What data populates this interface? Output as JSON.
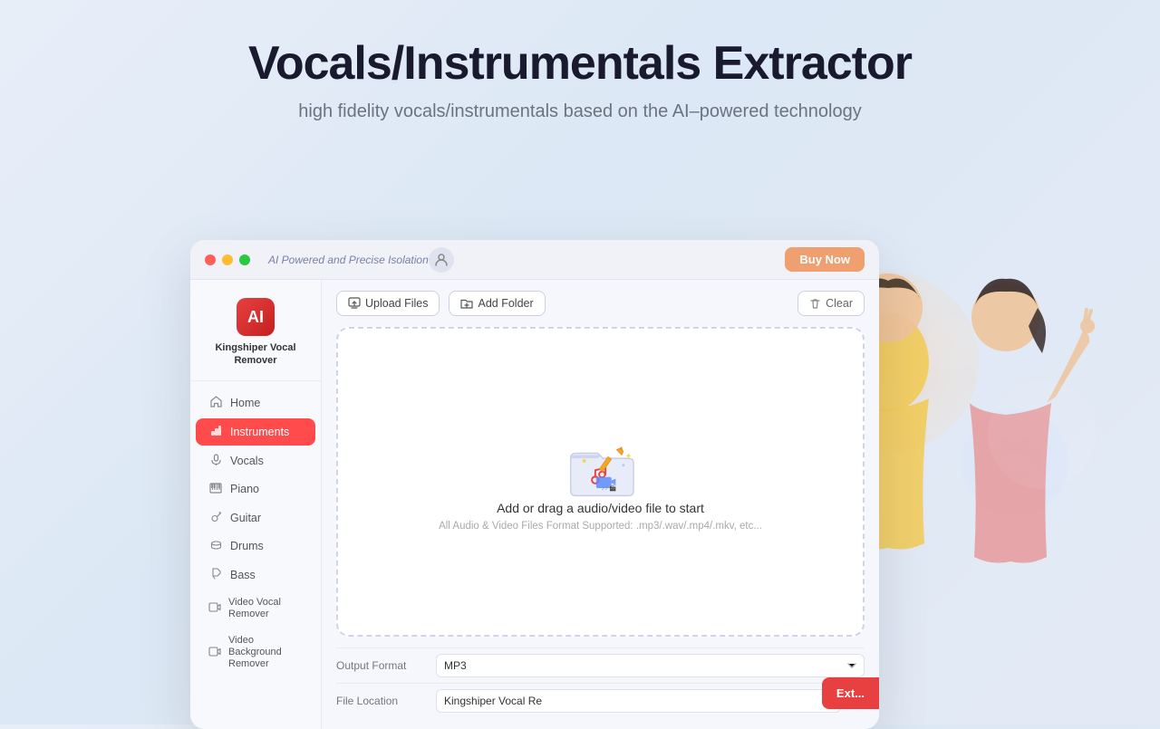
{
  "header": {
    "title": "Vocals/Instrumentals Extractor",
    "subtitle": "high fidelity vocals/instrumentals based on the AI–powered technology"
  },
  "titlebar": {
    "tagline": "AI Powered and Precise Isolation",
    "buy_now": "Buy Now"
  },
  "app": {
    "logo_label": "AI",
    "app_name": "Kingshiper Vocal Remover"
  },
  "sidebar": {
    "items": [
      {
        "id": "home",
        "label": "Home",
        "icon": "🏠"
      },
      {
        "id": "instruments",
        "label": "Instruments",
        "icon": "🎸",
        "active": true
      },
      {
        "id": "vocals",
        "label": "Vocals",
        "icon": "🎤"
      },
      {
        "id": "piano",
        "label": "Piano",
        "icon": "🎹"
      },
      {
        "id": "guitar",
        "label": "Guitar",
        "icon": "🎸"
      },
      {
        "id": "drums",
        "label": "Drums",
        "icon": "🥁"
      },
      {
        "id": "bass",
        "label": "Bass",
        "icon": "🎵"
      },
      {
        "id": "video-vocal",
        "label": "Video Vocal Remover",
        "icon": "🎬"
      },
      {
        "id": "video-bg",
        "label": "Video Background Remover",
        "icon": "🎬"
      }
    ]
  },
  "toolbar": {
    "upload_label": "Upload Files",
    "add_folder_label": "Add Folder",
    "clear_label": "Clear"
  },
  "dropzone": {
    "main_text": "Add or drag a audio/video file to start",
    "sub_text": "All Audio & Video Files Format Supported: .mp3/.wav/.mp4/.mkv, etc..."
  },
  "settings": {
    "output_format_label": "Output Format",
    "output_format_value": "MP3",
    "file_location_label": "File Location",
    "file_location_value": "Kingshiper Vocal Re"
  },
  "export_btn_label": "Ext...",
  "colors": {
    "accent_red": "#e84040",
    "accent_orange": "#f0a070",
    "active_nav": "#ff4b4b"
  }
}
